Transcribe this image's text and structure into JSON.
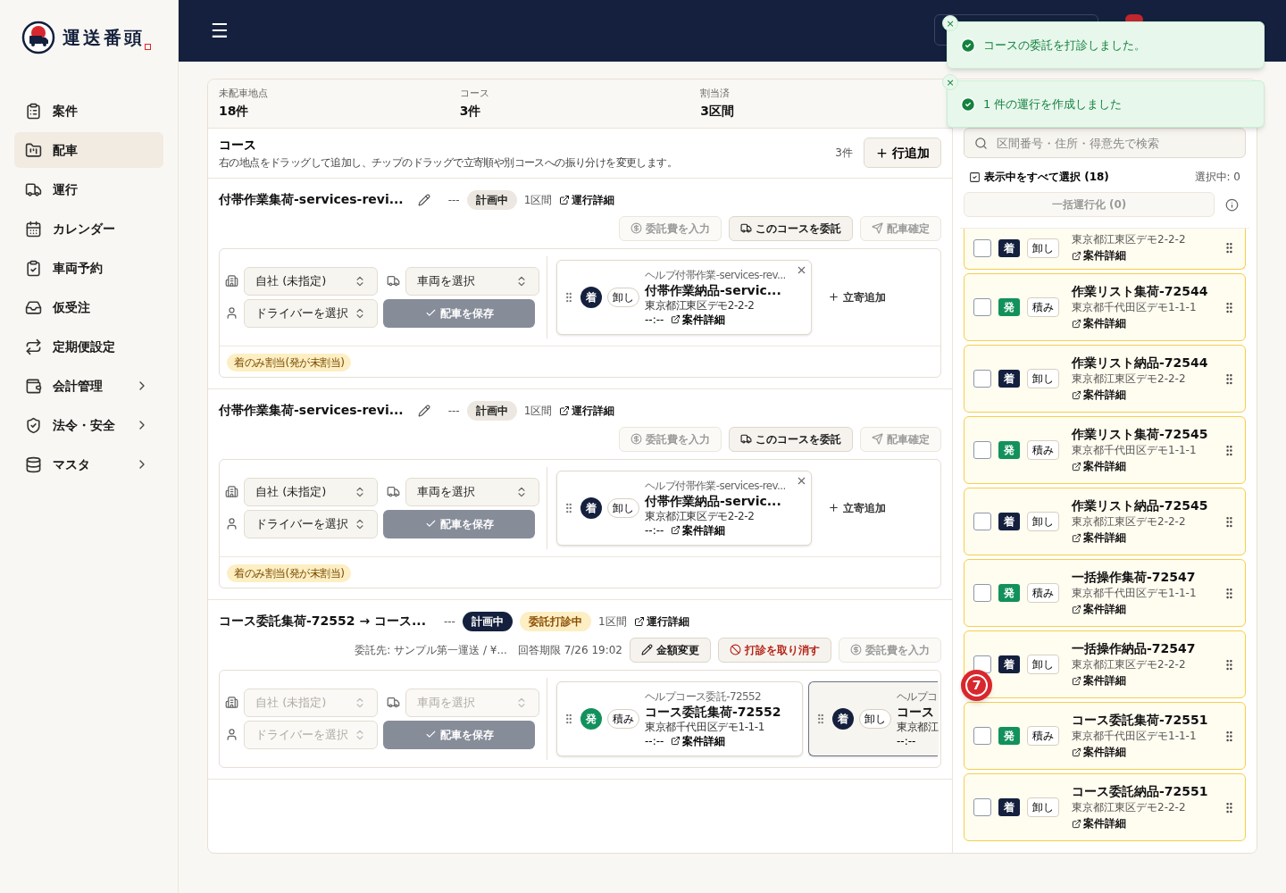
{
  "brand": {
    "name": "運送番頭"
  },
  "sidebar": {
    "items": [
      {
        "label": "案件",
        "selected": false,
        "submenu": false
      },
      {
        "label": "配車",
        "selected": true,
        "submenu": false
      },
      {
        "label": "運行",
        "selected": false,
        "submenu": false
      },
      {
        "label": "カレンダー",
        "selected": false,
        "submenu": false
      },
      {
        "label": "車両予約",
        "selected": false,
        "submenu": false
      },
      {
        "label": "仮受注",
        "selected": false,
        "submenu": false
      },
      {
        "label": "定期便設定",
        "selected": false,
        "submenu": false
      },
      {
        "label": "会計管理",
        "selected": false,
        "submenu": true
      },
      {
        "label": "法令・安全",
        "selected": false,
        "submenu": true
      },
      {
        "label": "マスタ",
        "selected": false,
        "submenu": true
      }
    ]
  },
  "header": {
    "menu_icon": "☰"
  },
  "stats": [
    {
      "label": "未配車地点",
      "value": "18件"
    },
    {
      "label": "コース",
      "value": "3件"
    },
    {
      "label": "割当済",
      "value": "3区間"
    }
  ],
  "courses_header": {
    "title": "コース",
    "description": "右の地点をドラッグして追加し、チップのドラッグで立寄順や別コースへの振り分けを変更します。",
    "count": "3件",
    "add_button": "行追加"
  },
  "courses": [
    {
      "title": "付帯作業集荷-services-revi...",
      "editable": true,
      "vehicle_no": "---",
      "status": {
        "label": "計画中",
        "kind": "planned"
      },
      "sections": "1区間",
      "link": "運行詳細",
      "actions": [
        {
          "label": "委託費を入力",
          "kind": "fee",
          "disabled": true
        },
        {
          "label": "このコースを委託",
          "kind": "consign",
          "disabled": false
        },
        {
          "label": "配車確定",
          "kind": "confirm",
          "disabled": true
        }
      ],
      "company": "自社 (未指定)",
      "vehicle": "車両を選択",
      "driver": "ドライバーを選択",
      "save": "配車を保存",
      "disabled": false,
      "stops": [
        {
          "help": "ヘルプ付帯作業-services-rev...",
          "chip": {
            "label": "着",
            "kind": "arrive"
          },
          "action": "卸し",
          "title": "付帯作業納品-servic...",
          "address": "東京都江東区デモ2-2-2",
          "time": "--:--",
          "link": "案件詳細",
          "removable": true,
          "selected": false
        }
      ],
      "add_stop": "立寄追加",
      "note": "着のみ割当(発が未割当)"
    },
    {
      "title": "付帯作業集荷-services-revi...",
      "editable": true,
      "vehicle_no": "---",
      "status": {
        "label": "計画中",
        "kind": "planned"
      },
      "sections": "1区間",
      "link": "運行詳細",
      "actions": [
        {
          "label": "委託費を入力",
          "kind": "fee",
          "disabled": true
        },
        {
          "label": "このコースを委託",
          "kind": "consign",
          "disabled": false
        },
        {
          "label": "配車確定",
          "kind": "confirm",
          "disabled": true
        }
      ],
      "company": "自社 (未指定)",
      "vehicle": "車両を選択",
      "driver": "ドライバーを選択",
      "save": "配車を保存",
      "disabled": false,
      "stops": [
        {
          "help": "ヘルプ付帯作業-services-rev...",
          "chip": {
            "label": "着",
            "kind": "arrive"
          },
          "action": "卸し",
          "title": "付帯作業納品-servic...",
          "address": "東京都江東区デモ2-2-2",
          "time": "--:--",
          "link": "案件詳細",
          "removable": true,
          "selected": false
        }
      ],
      "add_stop": "立寄追加",
      "note": "着のみ割当(発が未割当)"
    },
    {
      "title": "コース委託集荷-72552 → コース...",
      "editable": false,
      "vehicle_no": "---",
      "status": {
        "label": "計画中",
        "kind": "consigning"
      },
      "extra_badge": "委託打診中",
      "sections": "1区間",
      "link": "運行詳細",
      "consign": {
        "to": "委託先: サンプル第一運送 / ¥...",
        "deadline": "回答期限 7/26 19:02"
      },
      "actions": [
        {
          "label": "金額変更",
          "kind": "amount",
          "disabled": false
        },
        {
          "label": "打診を取り消す",
          "kind": "cancel",
          "disabled": false
        },
        {
          "label": "委託費を入力",
          "kind": "fee",
          "disabled": true
        }
      ],
      "company": "自社 (未指定)",
      "vehicle": "車両を選択",
      "driver": "ドライバーを選択",
      "save": "配車を保存",
      "disabled": true,
      "stops": [
        {
          "help": "ヘルプコース委託-72552",
          "chip": {
            "label": "発",
            "kind": "depart"
          },
          "action": "積み",
          "title": "コース委託集荷-72552",
          "address": "東京都千代田区デモ1-1-1",
          "time": "--:--",
          "link": "案件詳細",
          "removable": false,
          "selected": false
        },
        {
          "help": "ヘルプコ",
          "chip": {
            "label": "着",
            "kind": "arrive"
          },
          "action": "卸し",
          "title": "コース",
          "address": "東京都江",
          "time": "--:--",
          "removable": false,
          "selected": true
        }
      ]
    }
  ],
  "unassigned": {
    "search": {
      "placeholder": "区間番号・住所・得意先で検索"
    },
    "select_all": {
      "label": "表示中をすべて選択 (18)",
      "checked": false
    },
    "selected_count": "選択中: 0",
    "bulk_button": "一括運行化 (0)",
    "items": [
      {
        "chip": {
          "label": "着",
          "kind": "arrive"
        },
        "action": "卸し",
        "address": "東京都江東区デモ2-2-2",
        "link": "案件詳細",
        "checked": false
      },
      {
        "title": "作業リスト集荷-72544",
        "chip": {
          "label": "発",
          "kind": "depart"
        },
        "action": "積み",
        "address": "東京都千代田区デモ1-1-1",
        "link": "案件詳細",
        "checked": false
      },
      {
        "title": "作業リスト納品-72544",
        "chip": {
          "label": "着",
          "kind": "arrive"
        },
        "action": "卸し",
        "address": "東京都江東区デモ2-2-2",
        "link": "案件詳細",
        "checked": false
      },
      {
        "title": "作業リスト集荷-72545",
        "chip": {
          "label": "発",
          "kind": "depart"
        },
        "action": "積み",
        "address": "東京都千代田区デモ1-1-1",
        "link": "案件詳細",
        "checked": false
      },
      {
        "title": "作業リスト納品-72545",
        "chip": {
          "label": "着",
          "kind": "arrive"
        },
        "action": "卸し",
        "address": "東京都江東区デモ2-2-2",
        "link": "案件詳細",
        "checked": false
      },
      {
        "title": "一括操作集荷-72547",
        "chip": {
          "label": "発",
          "kind": "depart"
        },
        "action": "積み",
        "address": "東京都千代田区デモ1-1-1",
        "link": "案件詳細",
        "checked": false
      },
      {
        "title": "一括操作納品-72547",
        "chip": {
          "label": "着",
          "kind": "arrive"
        },
        "action": "卸し",
        "address": "東京都江東区デモ2-2-2",
        "link": "案件詳細",
        "checked": false
      },
      {
        "title": "コース委託集荷-72551",
        "chip": {
          "label": "発",
          "kind": "depart"
        },
        "action": "積み",
        "address": "東京都千代田区デモ1-1-1",
        "link": "案件詳細",
        "checked": false
      },
      {
        "title": "コース委託納品-72551",
        "chip": {
          "label": "着",
          "kind": "arrive"
        },
        "action": "卸し",
        "address": "東京都江東区デモ2-2-2",
        "link": "案件詳細",
        "checked": false
      }
    ]
  },
  "toasts": [
    {
      "message": "コースの委託を打診しました。",
      "close": "×"
    },
    {
      "message": "1 件の運行を作成しました",
      "close": "×"
    }
  ],
  "step_marker": "7"
}
